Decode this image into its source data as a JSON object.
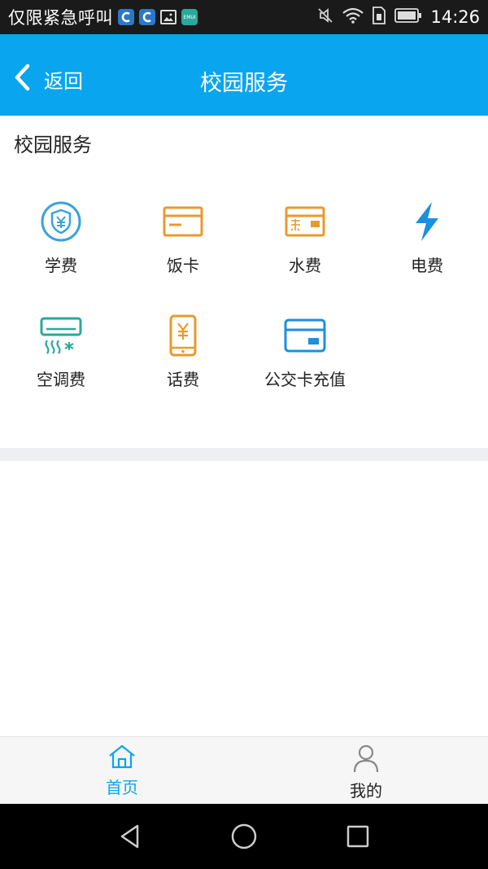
{
  "status_bar": {
    "carrier_text": "仅限紧急呼叫",
    "emui_badge": "EMUI",
    "time": "14:26"
  },
  "header": {
    "back_label": "返回",
    "title": "校园服务",
    "bg_color": "#09a6ef"
  },
  "section": {
    "title": "校园服务",
    "services": [
      {
        "label": "学费",
        "icon": "tuition-shield-yen-icon",
        "color": "#3aa2dc"
      },
      {
        "label": "饭卡",
        "icon": "meal-card-icon",
        "color": "#e99a2c"
      },
      {
        "label": "水费",
        "icon": "water-card-icon",
        "color": "#e99a2c"
      },
      {
        "label": "电费",
        "icon": "lightning-bolt-icon",
        "color": "#1b8fe0"
      },
      {
        "label": "空调费",
        "icon": "air-conditioner-icon",
        "color": "#2aa89b"
      },
      {
        "label": "话费",
        "icon": "phone-yen-icon",
        "color": "#e99a2c"
      },
      {
        "label": "公交卡充值",
        "icon": "bus-card-icon",
        "color": "#1b8fe0"
      }
    ]
  },
  "bottom_nav": {
    "home_label": "首页",
    "mine_label": "我的",
    "active_color": "#09a6ef"
  }
}
